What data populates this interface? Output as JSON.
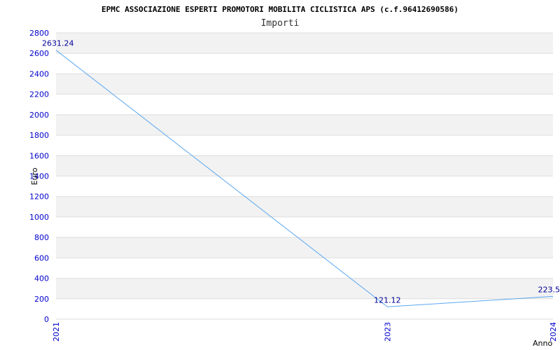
{
  "chart_data": {
    "type": "line",
    "title": "EPMC ASSOCIAZIONE ESPERTI PROMOTORI MOBILITA CICLISTICA APS (c.f.96412690586)",
    "subtitle": "Importi",
    "xlabel": "Anno",
    "ylabel": "Euro",
    "x": [
      "2021",
      "2023",
      "2024"
    ],
    "x_numeric": [
      2021,
      2023,
      2024
    ],
    "values": [
      2631.24,
      121.12,
      223.5
    ],
    "data_labels": [
      "2631.24",
      "121.12",
      "223.5"
    ],
    "ylim": [
      0,
      2800
    ],
    "y_ticks": [
      0,
      200,
      400,
      600,
      800,
      1000,
      1200,
      1400,
      1600,
      1800,
      2000,
      2200,
      2400,
      2600,
      2800
    ],
    "grid": true,
    "colors": {
      "line": "#5aa7f0",
      "band_alt": "#f2f2f2",
      "band": "#ffffff",
      "grid": "#dddddd",
      "tick_text": "#0000cc",
      "data_label": "#000099"
    }
  }
}
